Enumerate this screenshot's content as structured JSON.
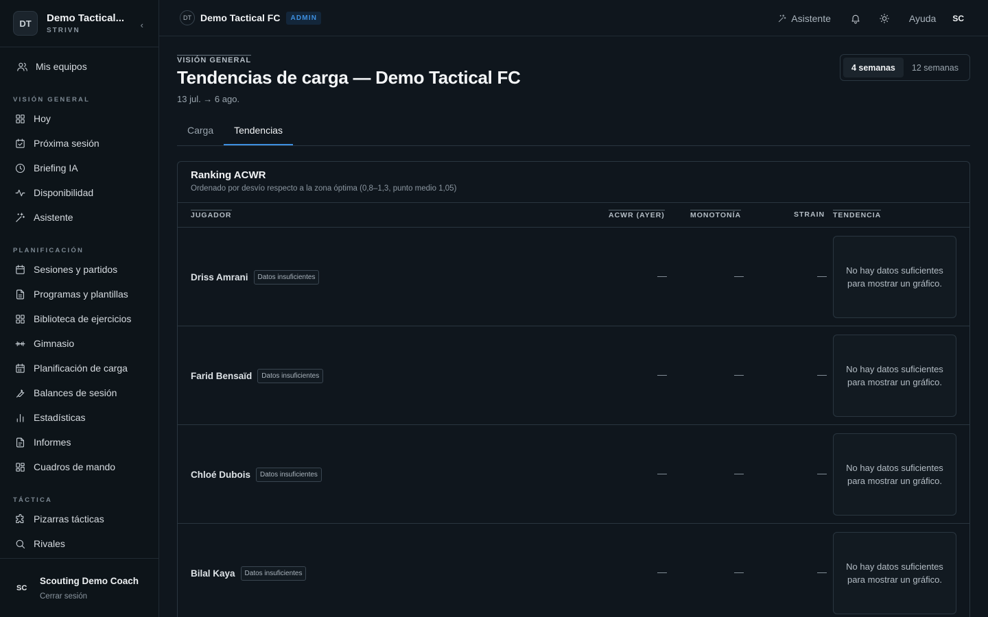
{
  "sidebar": {
    "team_initials": "DT",
    "team_name": "Demo Tactical...",
    "org": "STRIVN",
    "my_teams": "Mis equipos",
    "sections": {
      "overview": "VISIÓN GENERAL",
      "planning": "PLANIFICACIÓN",
      "tactics": "TÁCTICA"
    },
    "overview_items": [
      "Hoy",
      "Próxima sesión",
      "Briefing IA",
      "Disponibilidad",
      "Asistente"
    ],
    "planning_items": [
      "Sesiones y partidos",
      "Programas y plantillas",
      "Biblioteca de ejercicios",
      "Gimnasio",
      "Planificación de carga",
      "Balances de sesión",
      "Estadísticas",
      "Informes",
      "Cuadros de mando"
    ],
    "tactics_items": [
      "Pizarras tácticas",
      "Rivales"
    ],
    "user_initials": "SC",
    "user_name": "Scouting Demo Coach",
    "logout": "Cerrar sesión"
  },
  "topbar": {
    "team_initials": "DT",
    "team_name": "Demo Tactical FC",
    "badge": "ADMIN",
    "assistant": "Asistente",
    "help": "Ayuda",
    "user_initials": "SC"
  },
  "page": {
    "eyebrow": "VISIÓN GENERAL",
    "title": "Tendencias de carga — Demo Tactical FC",
    "date_range": "13 jul. → 6 ago.",
    "range_options": [
      "4 semanas",
      "12 semanas"
    ],
    "active_range": "4 semanas",
    "tabs": [
      "Carga",
      "Tendencias"
    ],
    "active_tab": "Tendencias"
  },
  "ranking": {
    "title": "Ranking ACWR",
    "subtitle": "Ordenado por desvío respecto a la zona óptima (0,8–1,3, punto medio 1,05)",
    "columns": {
      "player": "JUGADOR",
      "acwr": "ACWR (AYER)",
      "monotony": "MONOTONÍA",
      "strain": "STRAIN",
      "trend": "TENDENCIA"
    },
    "rows": [
      {
        "name": "Driss Amrani",
        "tag": "Datos insuficientes",
        "acwr": "—",
        "monotony": "—",
        "strain": "—",
        "trend": "No hay datos suficientes para mostrar un gráfico."
      },
      {
        "name": "Farid Bensaïd",
        "tag": "Datos insuficientes",
        "acwr": "—",
        "monotony": "—",
        "strain": "—",
        "trend": "No hay datos suficientes para mostrar un gráfico."
      },
      {
        "name": "Chloé Dubois",
        "tag": "Datos insuficientes",
        "acwr": "—",
        "monotony": "—",
        "strain": "—",
        "trend": "No hay datos suficientes para mostrar un gráfico."
      },
      {
        "name": "Bilal Kaya",
        "tag": "Datos insuficientes",
        "acwr": "—",
        "monotony": "—",
        "strain": "—",
        "trend": "No hay datos suficientes para mostrar un gráfico."
      }
    ]
  },
  "colors": {
    "background": "#0f161d",
    "accent": "#3d8fe0",
    "border": "#2a3640"
  }
}
